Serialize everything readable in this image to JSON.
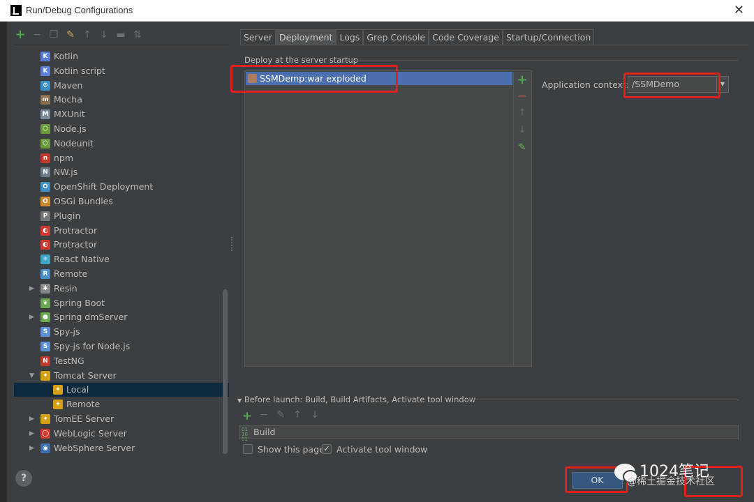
{
  "window": {
    "title": "Run/Debug Configurations",
    "close_glyph": "✕"
  },
  "toolbar": {
    "items": [
      "plus-icon",
      "minus-icon",
      "copy-icon",
      "wrench-icon",
      "arrow-up-icon",
      "arrow-down-icon",
      "folder-icon",
      "sort-icon"
    ]
  },
  "tree": {
    "items": [
      {
        "label": "Kotlin",
        "icon": "kotlin-icon",
        "color": "#5b7fd6",
        "glyph": "K"
      },
      {
        "label": "Kotlin script",
        "icon": "kotlin-script-icon",
        "color": "#5b7fd6",
        "glyph": "K"
      },
      {
        "label": "Maven",
        "icon": "maven-icon",
        "color": "#3b8fc7",
        "glyph": "⚙"
      },
      {
        "label": "Mocha",
        "icon": "mocha-icon",
        "color": "#8d6e4a",
        "glyph": "m"
      },
      {
        "label": "MXUnit",
        "icon": "mxunit-icon",
        "color": "#7a8a9a",
        "glyph": "M"
      },
      {
        "label": "Node.js",
        "icon": "nodejs-icon",
        "color": "#6a9a3a",
        "glyph": "⬡"
      },
      {
        "label": "Nodeunit",
        "icon": "nodeunit-icon",
        "color": "#6a9a3a",
        "glyph": "⬡"
      },
      {
        "label": "npm",
        "icon": "npm-icon",
        "color": "#c0392b",
        "glyph": "n"
      },
      {
        "label": "NW.js",
        "icon": "nwjs-icon",
        "color": "#6b7b8b",
        "glyph": "N"
      },
      {
        "label": "OpenShift Deployment",
        "icon": "openshift-icon",
        "color": "#3a8fc4",
        "glyph": "O"
      },
      {
        "label": "OSGi Bundles",
        "icon": "osgi-icon",
        "color": "#d28a2e",
        "glyph": "O"
      },
      {
        "label": "Plugin",
        "icon": "plugin-icon",
        "color": "#777777",
        "glyph": "P"
      },
      {
        "label": "Protractor",
        "icon": "protractor-icon",
        "color": "#d33a2f",
        "glyph": "◐"
      },
      {
        "label": "Protractor",
        "icon": "protractor-icon",
        "color": "#d33a2f",
        "glyph": "◐"
      },
      {
        "label": "React Native",
        "icon": "react-icon",
        "color": "#3aa7c9",
        "glyph": "⚛"
      },
      {
        "label": "Remote",
        "icon": "remote-icon",
        "color": "#4a8fc8",
        "glyph": "R"
      },
      {
        "label": "Resin",
        "icon": "resin-icon",
        "color": "#888888",
        "glyph": "✱",
        "expandable": true
      },
      {
        "label": "Spring Boot",
        "icon": "spring-boot-icon",
        "color": "#6aa84f",
        "glyph": "❦"
      },
      {
        "label": "Spring dmServer",
        "icon": "spring-dm-icon",
        "color": "#6aa84f",
        "glyph": "●",
        "expandable": true
      },
      {
        "label": "Spy-js",
        "icon": "spyjs-icon",
        "color": "#5b8fd6",
        "glyph": "S"
      },
      {
        "label": "Spy-js for Node.js",
        "icon": "spyjs-node-icon",
        "color": "#5b8fd6",
        "glyph": "S"
      },
      {
        "label": "TestNG",
        "icon": "testng-icon",
        "color": "#c0392b",
        "glyph": "N"
      },
      {
        "label": "Tomcat Server",
        "icon": "tomcat-icon",
        "color": "#d4a017",
        "glyph": "✦",
        "expanded": true
      },
      {
        "label": "Local",
        "icon": "tomcat-icon",
        "color": "#d4a017",
        "glyph": "✦",
        "child": true,
        "selected": true
      },
      {
        "label": "Remote",
        "icon": "tomcat-icon",
        "color": "#d4a017",
        "glyph": "✦",
        "child": true
      },
      {
        "label": "TomEE Server",
        "icon": "tomee-icon",
        "color": "#d4a017",
        "glyph": "✦",
        "expandable": true
      },
      {
        "label": "WebLogic Server",
        "icon": "weblogic-icon",
        "color": "#d33a2f",
        "glyph": "◯",
        "expandable": true
      },
      {
        "label": "WebSphere Server",
        "icon": "websphere-icon",
        "color": "#3a6fb0",
        "glyph": "◉",
        "expandable": true
      }
    ]
  },
  "tabs": [
    {
      "label": "Server",
      "active": false
    },
    {
      "label": "Deployment",
      "active": true
    },
    {
      "label": "Logs",
      "active": false
    },
    {
      "label": "Grep Console",
      "active": false
    },
    {
      "label": "Code Coverage",
      "active": false
    },
    {
      "label": "Startup/Connection",
      "active": false
    }
  ],
  "deployment": {
    "section_label": "Deploy at the server startup",
    "artifact": "SSMDemp:war exploded",
    "context_label": "Application context:",
    "context_value": "/SSMDemo"
  },
  "before_launch": {
    "label": "Before launch: Build, Build Artifacts, Activate tool window",
    "build_item": "Build",
    "build_glyph": "01\n10\n01",
    "show_page": "Show this page",
    "activate_tool_window": "Activate tool window"
  },
  "buttons": {
    "ok": "OK",
    "help": "?"
  },
  "watermark": {
    "main": "1024笔记",
    "sub": "@稀土掘金技术社区"
  },
  "colors": {
    "accent": "#4b6eaf",
    "selected_tree": "#0d293e",
    "ok_button": "#365880",
    "highlight": "#e0201c"
  }
}
